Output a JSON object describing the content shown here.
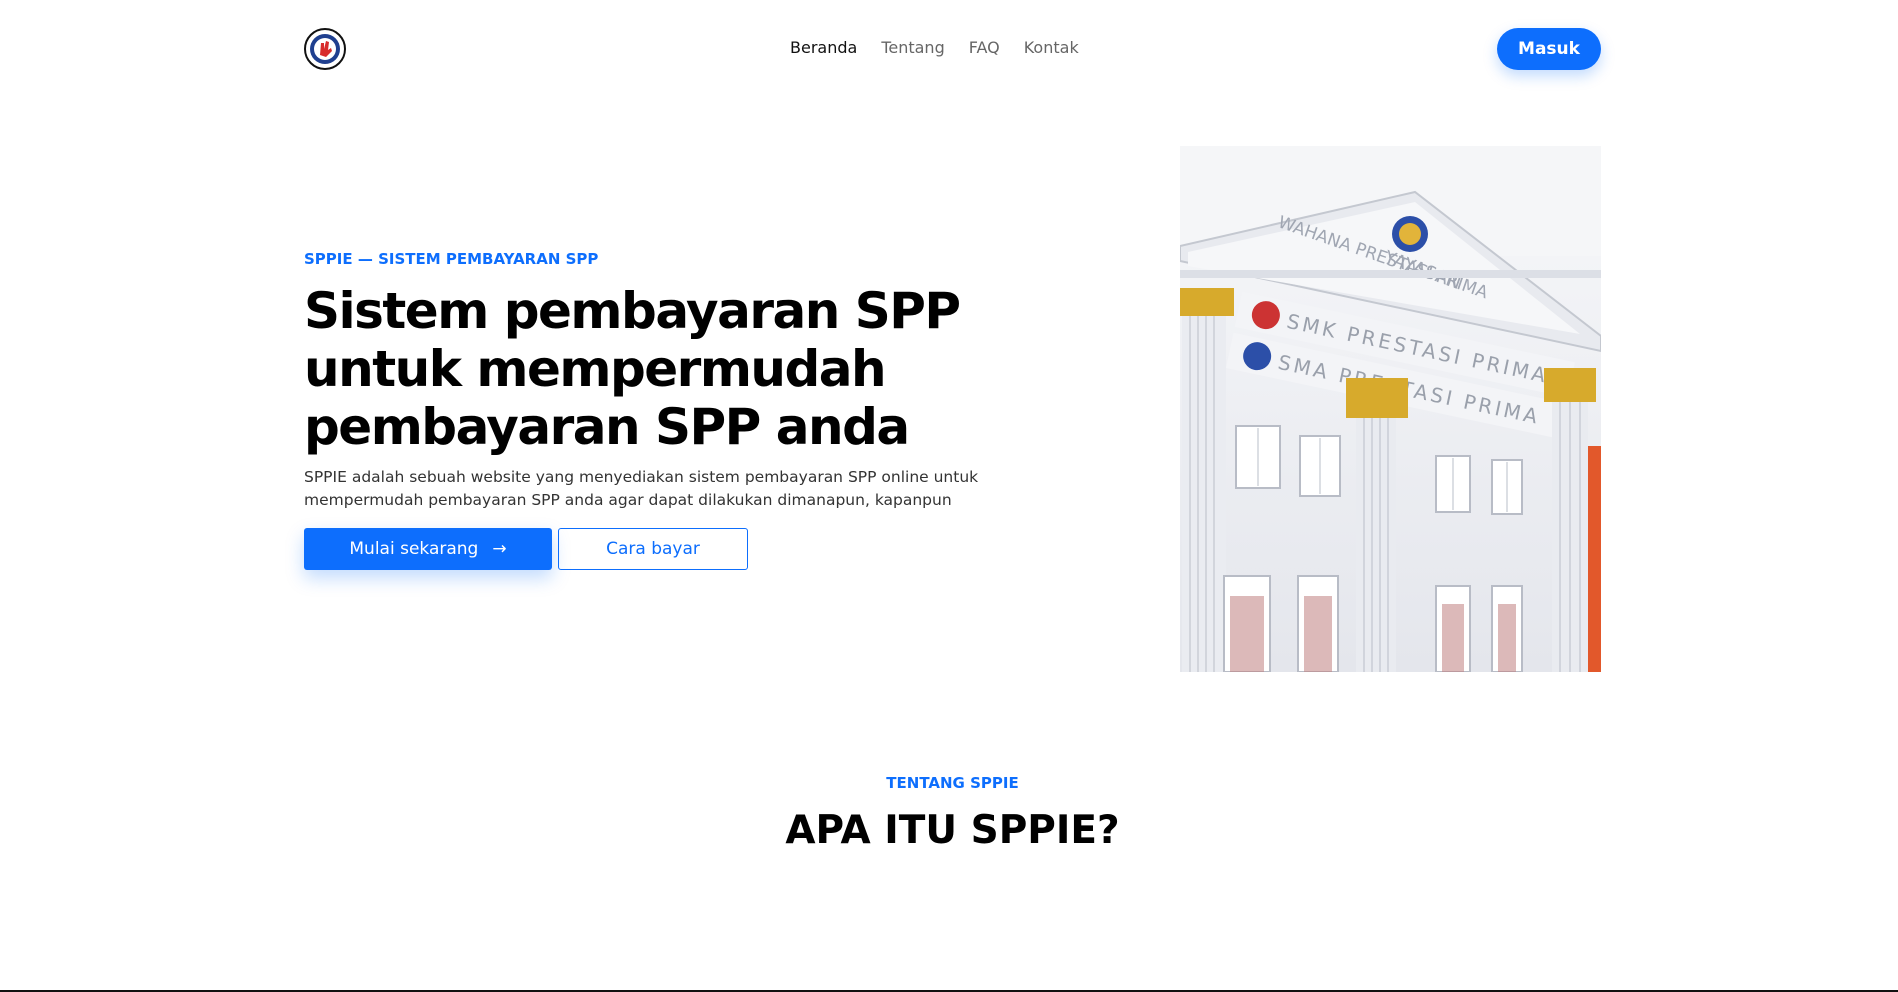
{
  "nav": {
    "items": [
      {
        "label": "Beranda",
        "active": true
      },
      {
        "label": "Tentang",
        "active": false
      },
      {
        "label": "FAQ",
        "active": false
      },
      {
        "label": "Kontak",
        "active": false
      }
    ],
    "login_label": "Masuk"
  },
  "hero": {
    "eyebrow": "SPPIE — SISTEM PEMBAYARAN SPP",
    "headline": "Sistem pembayaran SPP untuk mempermudah pembayaran SPP anda",
    "description": "SPPIE adalah sebuah website yang menyediakan sistem pembayaran SPP online untuk mempermudah pembayaran SPP anda agar dapat dilakukan dimanapun, kapanpun",
    "primary_cta": "Mulai sekarang",
    "primary_cta_icon": "arrow-right-icon",
    "secondary_cta": "Cara bayar",
    "image": {
      "pediment_line1": "YAYASAN",
      "pediment_line2": "WAHANA PRESTASI PRIMA",
      "sign1": "SMK PRESTASI PRIMA",
      "sign2": "SMA PRESTASI PRIMA"
    }
  },
  "about": {
    "eyebrow": "TENTANG SPPIE",
    "title": "APA ITU SPPIE?"
  },
  "colors": {
    "accent": "#0d6efd",
    "text": "#111111",
    "muted": "#666666",
    "background": "#ffffff"
  }
}
